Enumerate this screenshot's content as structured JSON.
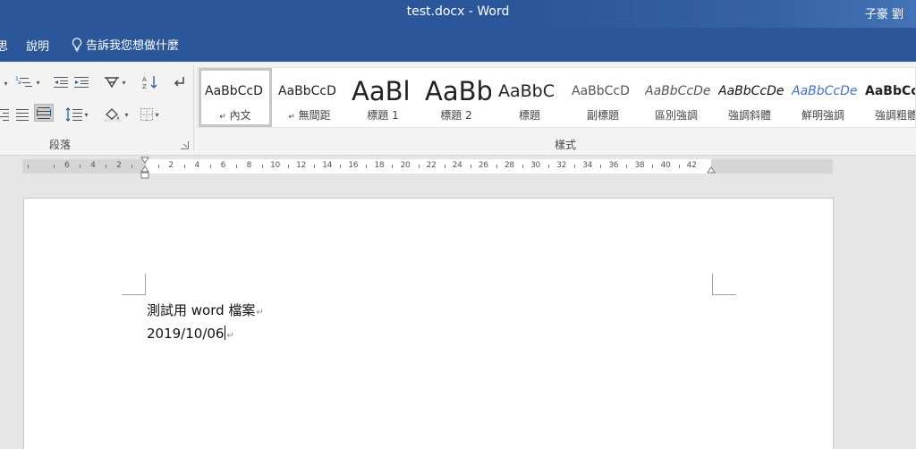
{
  "titlebar": {
    "title": "test.docx  -  Word",
    "user": "子豪 劉"
  },
  "tabs": {
    "partial": "思",
    "help": "說明",
    "tell_me": "告訴我您想做什麼"
  },
  "ribbon": {
    "paragraph_label": "段落",
    "styles_label": "樣式",
    "styles": [
      {
        "sample": "AaBbCcD",
        "mark": "↵",
        "name": "內文"
      },
      {
        "sample": "AaBbCcD",
        "mark": "↵",
        "name": "無間距"
      },
      {
        "sample": "AaBl",
        "mark": "",
        "name": "標題 1"
      },
      {
        "sample": "AaBb",
        "mark": "",
        "name": "標題 2"
      },
      {
        "sample": "AaBbC",
        "mark": "",
        "name": "標題"
      },
      {
        "sample": "AaBbCcD",
        "mark": "",
        "name": "副標題"
      },
      {
        "sample": "AaBbCcDe",
        "mark": "",
        "name": "區別強調"
      },
      {
        "sample": "AaBbCcDe",
        "mark": "",
        "name": "強調斜體"
      },
      {
        "sample": "AaBbCcDe",
        "mark": "",
        "name": "鮮明強調"
      },
      {
        "sample": "AaBbCcDe",
        "mark": "",
        "name": "強調粗體"
      }
    ]
  },
  "ruler": {
    "labels_left": [
      "6",
      "4",
      "2"
    ],
    "labels_right": [
      "2",
      "4",
      "6",
      "8",
      "10",
      "12",
      "14",
      "16",
      "18",
      "20",
      "22",
      "24",
      "26",
      "28",
      "30",
      "32",
      "34",
      "36",
      "38",
      "40",
      "42"
    ]
  },
  "document": {
    "line1": "測試用  word  檔案",
    "line2": "2019/10/06",
    "para_mark": "↵"
  },
  "colors": {
    "word_blue": "#2b579a",
    "ribbon_bg": "#f3f3f3",
    "canvas_bg": "#e6e6e6"
  }
}
